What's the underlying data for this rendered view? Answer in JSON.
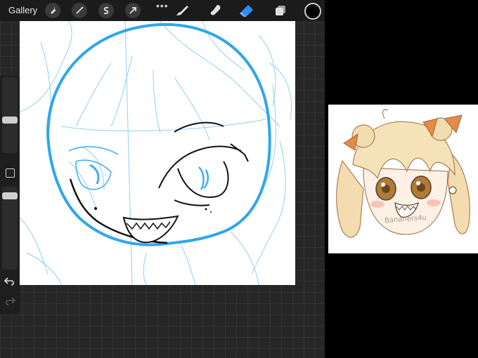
{
  "topbar": {
    "gallery_label": "Gallery",
    "tools": [
      {
        "name": "actions",
        "icon": "wrench-icon"
      },
      {
        "name": "adjustments",
        "icon": "magic-wand-icon"
      },
      {
        "name": "selection",
        "icon": "selection-s-icon"
      },
      {
        "name": "transform",
        "icon": "transform-arrow-icon"
      },
      {
        "name": "more",
        "icon": "more-dots-icon"
      },
      {
        "name": "brush",
        "icon": "brush-icon"
      },
      {
        "name": "smudge",
        "icon": "smudge-icon"
      },
      {
        "name": "eraser",
        "icon": "eraser-icon",
        "active": true
      },
      {
        "name": "layers",
        "icon": "layers-icon"
      }
    ],
    "current_color": "#000000",
    "active_tool_color": "#2f8cff"
  },
  "sidebar": {
    "brush_size_level": 0.47,
    "opacity_level": 0.9
  },
  "reference": {
    "signature_text": "Bananers4u"
  },
  "colors": {
    "sketch_blue": "#3bb0ee",
    "ink": "#111111"
  }
}
